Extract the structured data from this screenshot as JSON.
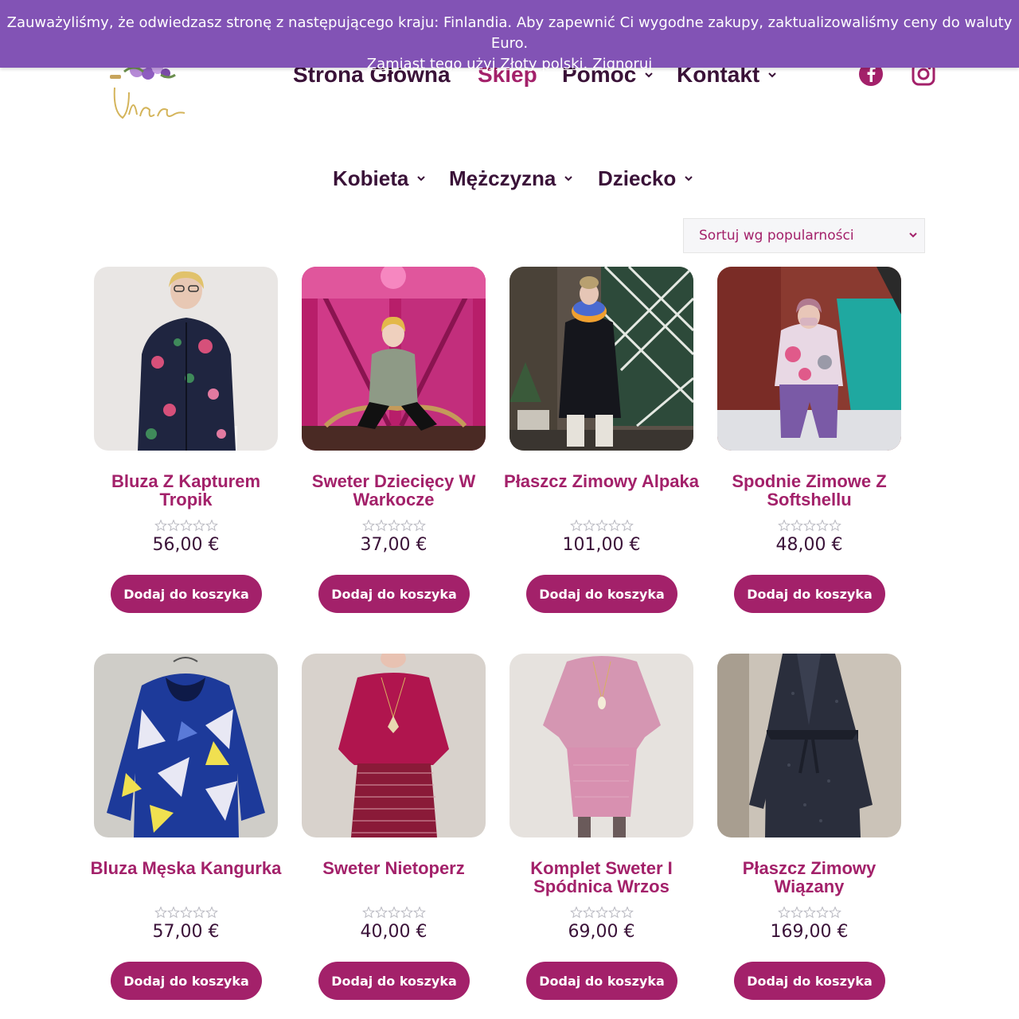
{
  "notice": {
    "message": "Zauważyliśmy, że odwiedzasz stronę z następującego kraju: Finlandia. Aby zapewnić Ci wygodne zakupy, zaktualizowaliśmy ceny do waluty Euro.",
    "switch_link": "Zamiast tego użyj Złoty polski.",
    "ignore_link": "Zignoruj"
  },
  "header": {
    "logo_text": "Ulala",
    "nav": [
      {
        "label": "Strona Główna",
        "dropdown": false,
        "active": false
      },
      {
        "label": "Sklep",
        "dropdown": false,
        "active": true
      },
      {
        "label": "Pomoc",
        "dropdown": true,
        "active": false
      },
      {
        "label": "Kontakt",
        "dropdown": true,
        "active": false
      }
    ],
    "social": [
      "facebook-icon",
      "instagram-icon"
    ]
  },
  "categories": [
    {
      "label": "Kobieta"
    },
    {
      "label": "Mężczyzna"
    },
    {
      "label": "Dziecko"
    }
  ],
  "sort": {
    "selected": "Sortuj wg popularności"
  },
  "products": [
    {
      "name": "Bluza Z Kapturem Tropik",
      "price": "56,00 €",
      "rating": 0,
      "button": "Dodaj do koszyka"
    },
    {
      "name": "Sweter Dziecięcy W Warkocze",
      "price": "37,00 €",
      "rating": 0,
      "button": "Dodaj do koszyka"
    },
    {
      "name": "Płaszcz Zimowy Alpaka",
      "price": "101,00 €",
      "rating": 0,
      "button": "Dodaj do koszyka"
    },
    {
      "name": "Spodnie Zimowe Z Softshellu",
      "price": "48,00 €",
      "rating": 0,
      "button": "Dodaj do koszyka"
    },
    {
      "name": "Bluza Męska Kangurka",
      "price": "57,00 €",
      "rating": 0,
      "button": "Dodaj do koszyka"
    },
    {
      "name": "Sweter Nietoperz",
      "price": "40,00 €",
      "rating": 0,
      "button": "Dodaj do koszyka"
    },
    {
      "name": "Komplet Sweter I Spódnica Wrzos",
      "price": "69,00 €",
      "rating": 0,
      "button": "Dodaj do koszyka"
    },
    {
      "name": "Płaszcz Zimowy Wiązany",
      "price": "169,00 €",
      "rating": 0,
      "button": "Dodaj do koszyka"
    }
  ],
  "colors": {
    "notice_bg": "#8253b5",
    "brand": "#a3216a",
    "nav_text": "#3a1238",
    "sort_bg": "#f6f6f8"
  }
}
